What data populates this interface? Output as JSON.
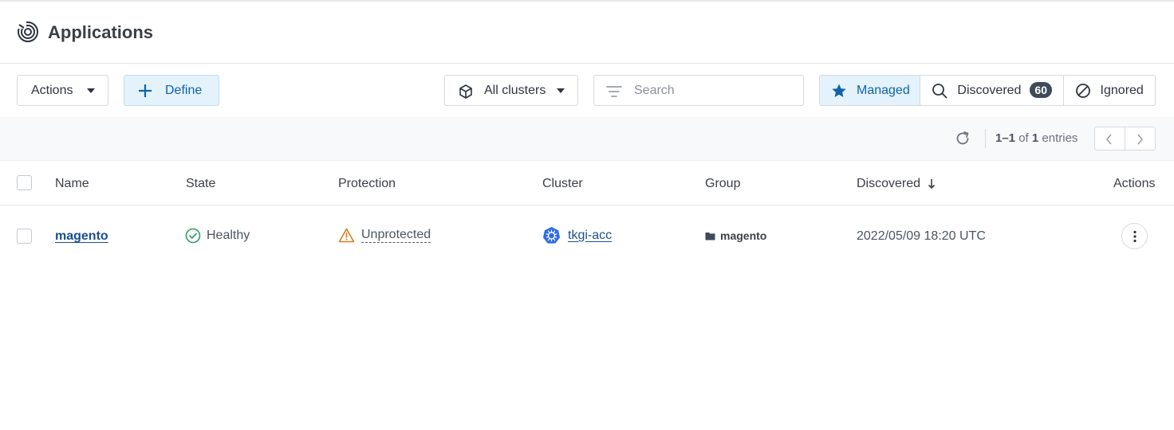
{
  "header": {
    "title": "Applications",
    "icon": "applications-spiral-icon"
  },
  "toolbar": {
    "actions_label": "Actions",
    "define_label": "Define",
    "clusters_label": "All clusters",
    "search_placeholder": "Search",
    "search_value": "",
    "filters": [
      {
        "label": "Managed",
        "icon": "star-icon",
        "active": true
      },
      {
        "label": "Discovered",
        "icon": "search-icon",
        "count": "60",
        "active": false
      },
      {
        "label": "Ignored",
        "icon": "ban-icon",
        "active": false
      }
    ]
  },
  "pager": {
    "range": "1–1",
    "of_word": "of",
    "total": "1",
    "entries_word": "entries"
  },
  "table": {
    "columns": [
      "Name",
      "State",
      "Protection",
      "Cluster",
      "Group",
      "Discovered",
      "Actions"
    ],
    "sort_column": "Discovered",
    "rows": [
      {
        "name": "magento",
        "state": "Healthy",
        "protection": "Unprotected",
        "cluster": "tkgi-acc",
        "group": "magento",
        "discovered": "2022/05/09 18:20 UTC"
      }
    ]
  },
  "colors": {
    "accent": "#1063a8",
    "accent_bg": "#e3f2fb",
    "healthy": "#2e9e6a",
    "warning": "#d97a1f",
    "kubernetes": "#326ce5"
  }
}
